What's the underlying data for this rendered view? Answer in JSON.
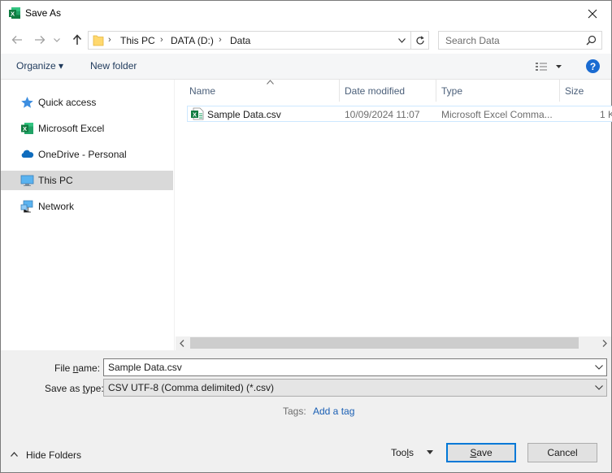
{
  "window": {
    "title": "Save As",
    "app_icon": "excel-icon",
    "close_glyph": "✕"
  },
  "nav": {
    "back_icon": "arrow-left-icon",
    "forward_icon": "arrow-right-icon",
    "recent_icon": "chevron-down-icon",
    "up_icon": "arrow-up-icon",
    "breadcrumbs": [
      "This PC",
      "DATA (D:)",
      "Data"
    ],
    "separator": "›"
  },
  "search": {
    "placeholder": "Search Data",
    "value": ""
  },
  "toolbar": {
    "organize": "Organize ▾",
    "new_folder": "New folder",
    "help": "?"
  },
  "sidebar": {
    "items": [
      {
        "label": "Quick access",
        "icon": "star-icon",
        "selected": false
      },
      {
        "label": "Microsoft Excel",
        "icon": "excel-icon",
        "selected": false
      },
      {
        "label": "OneDrive - Personal",
        "icon": "cloud-icon",
        "selected": false
      },
      {
        "label": "This PC",
        "icon": "computer-icon",
        "selected": true
      },
      {
        "label": "Network",
        "icon": "network-icon",
        "selected": false
      }
    ]
  },
  "files": {
    "columns": [
      "Name",
      "Date modified",
      "Type",
      "Size"
    ],
    "rows": [
      {
        "name": "Sample Data.csv",
        "date": "10/09/2024 11:07",
        "type": "Microsoft Excel Comma...",
        "size": "1 K"
      }
    ]
  },
  "form": {
    "filename_label_pre": "File ",
    "filename_label_u": "n",
    "filename_label_post": "ame:",
    "filename_value": "Sample Data.csv",
    "savetype_label_pre": "Save as ",
    "savetype_label_u": "t",
    "savetype_label_post": "ype:",
    "savetype_value": "CSV UTF-8 (Comma delimited) (*.csv)",
    "tags_label": "Tags:",
    "tags_link": "Add a tag"
  },
  "footer": {
    "hide_folders": "Hide Folders",
    "tools_pre": "Too",
    "tools_u": "l",
    "tools_post": "s",
    "save_u": "S",
    "save_post": "ave",
    "cancel": "Cancel"
  },
  "colors": {
    "accent": "#0078d7",
    "selected_nav": "#d9d9d9",
    "header_text": "#4c607a",
    "link": "#1a5fb4"
  }
}
